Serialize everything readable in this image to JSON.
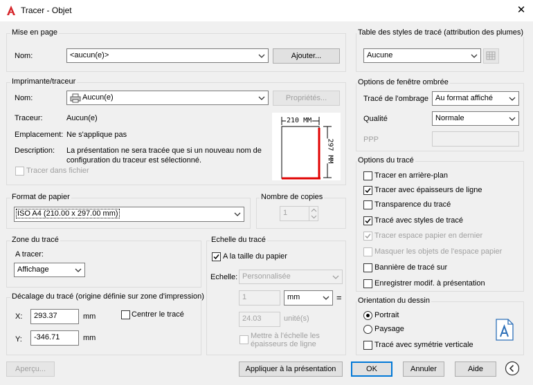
{
  "window": {
    "title": "Tracer - Objet",
    "close_glyph": "✕"
  },
  "page_setup": {
    "group_title": "Mise en page",
    "name_label": "Nom:",
    "name_value": "<aucun(e)>",
    "add_button": "Ajouter..."
  },
  "printer": {
    "group_title": "Imprimante/traceur",
    "name_label": "Nom:",
    "name_value": "Aucun(e)",
    "properties_button": "Propriétés...",
    "plotter_label": "Traceur:",
    "plotter_value": "Aucun(e)",
    "location_label": "Emplacement:",
    "location_value": "Ne s'applique pas",
    "description_label": "Description:",
    "description_line1": "La présentation ne sera tracée que si un nouveau nom de",
    "description_line2": "configuration du traceur est sélectionné.",
    "plot_to_file": "Tracer dans fichier",
    "preview_width": "210  MM",
    "preview_height": "297  MM"
  },
  "paper_size": {
    "group_title": "Format de papier",
    "value": "ISO A4 (210.00 x 297.00 mm)"
  },
  "copies": {
    "group_title": "Nombre de copies",
    "value": "1"
  },
  "plot_area": {
    "group_title": "Zone du tracé",
    "what_label": "A tracer:",
    "what_value": "Affichage"
  },
  "plot_offset": {
    "group_title": "Décalage du tracé (origine définie sur zone d'impression)",
    "x_label": "X:",
    "x_value": "293.37",
    "x_unit": "mm",
    "y_label": "Y:",
    "y_value": "-346.71",
    "y_unit": "mm",
    "center_label": "Centrer le tracé"
  },
  "plot_scale": {
    "group_title": "Echelle du tracé",
    "fit_paper": "A la taille du papier",
    "scale_label": "Echelle:",
    "scale_value": "Personnalisée",
    "value1": "1",
    "unit1": "mm",
    "equals": "=",
    "value2": "24.03",
    "unit2": "unité(s)",
    "scale_lineweights_line1": "Mettre à l'échelle les",
    "scale_lineweights_line2": "épaisseurs de ligne"
  },
  "plot_style_table": {
    "group_title": "Table des styles de tracé (attribution des plumes)",
    "value": "Aucune"
  },
  "shaded_viewport": {
    "group_title": "Options de fenêtre ombrée",
    "shade_label": "Tracé de l'ombrage",
    "shade_value": "Au format affiché",
    "quality_label": "Qualité",
    "quality_value": "Normale",
    "dpi_label": "PPP"
  },
  "plot_options": {
    "group_title": "Options du tracé",
    "opt1": "Tracer en arrière-plan",
    "opt2": "Tracer avec épaisseurs de ligne",
    "opt3": "Transparence du tracé",
    "opt4": "Tracé avec styles de tracé",
    "opt5": "Tracer espace papier en dernier",
    "opt6": "Masquer les objets de l'espace papier",
    "opt7": "Bannière de tracé sur",
    "opt8": "Enregistrer modif. à présentation"
  },
  "orientation": {
    "group_title": "Orientation du dessin",
    "portrait": "Portrait",
    "landscape": "Paysage",
    "upside_down": "Tracé avec symétrie verticale"
  },
  "footer": {
    "preview": "Aperçu...",
    "apply": "Appliquer à la présentation",
    "ok": "OK",
    "cancel": "Annuler",
    "help": "Aide"
  }
}
